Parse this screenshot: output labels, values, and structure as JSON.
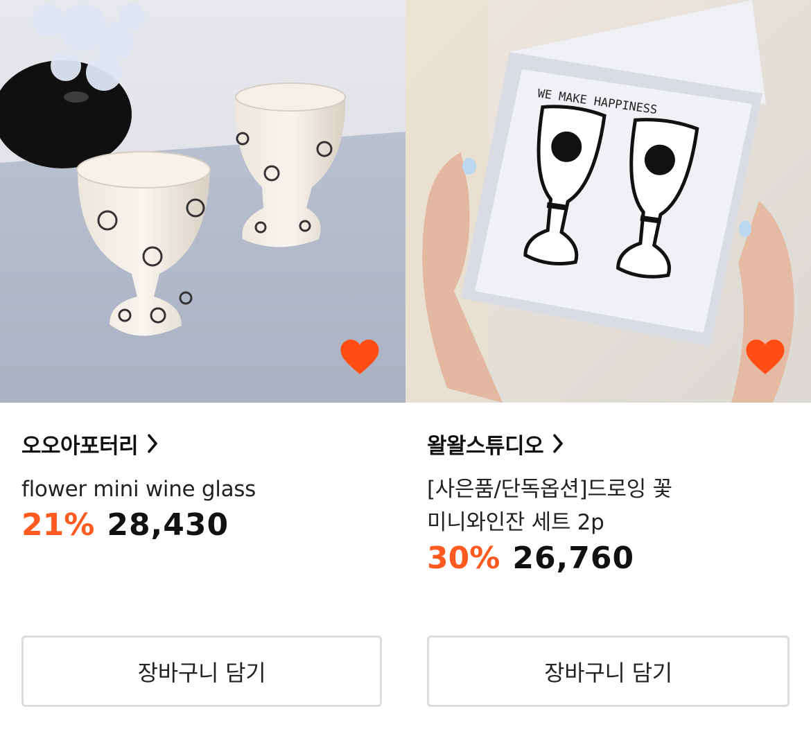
{
  "colors": {
    "accent": "#ff5a1f",
    "heart": "#ff4d14",
    "button_border": "#dcdcdc"
  },
  "icons": {
    "wishlist": "heart-icon",
    "brand_link": "chevron-right-icon"
  },
  "products": [
    {
      "brand": "오오아포터리",
      "name_lines": [
        "flower mini wine glass"
      ],
      "discount": "21%",
      "price": "28,430",
      "cart_label": "장바구니 담기",
      "wishlisted": true
    },
    {
      "brand": "왈왈스튜디오",
      "name_lines": [
        "[사은품/단독옵션]드로잉 꽃",
        "미니와인잔 세트 2p"
      ],
      "discount": "30%",
      "price": "26,760",
      "cart_label": "장바구니 담기",
      "wishlisted": true,
      "image_text": "WE MAKE HAPPINESS"
    }
  ]
}
